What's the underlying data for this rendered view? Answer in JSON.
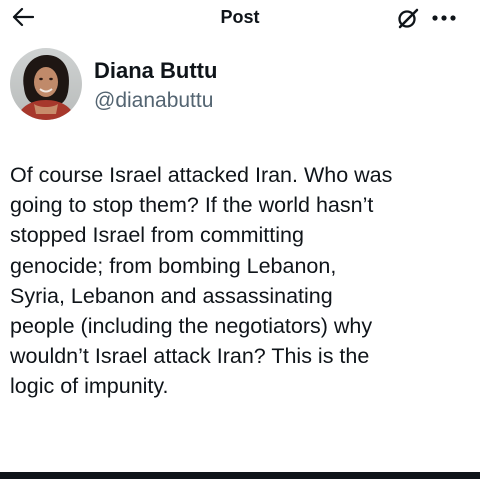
{
  "header": {
    "title": "Post",
    "back_icon": "arrow-left-icon",
    "grok_icon": "grok-icon",
    "more_icon": "more-horizontal-icon"
  },
  "author": {
    "name": "Diana Buttu",
    "handle": "@dianabuttu"
  },
  "tweet": {
    "lines": [
      "Of course Israel attacked Iran. Who was",
      "going to stop them? If the world hasn’t",
      "stopped Israel from committing",
      "genocide; from bombing Lebanon,",
      "Syria, Lebanon and assassinating",
      "people (including the negotiators) why",
      "wouldn’t Israel attack Iran? This is the",
      "logic of impunity."
    ]
  },
  "colors": {
    "text": "#0f1419",
    "secondary": "#536471",
    "background": "#ffffff"
  }
}
